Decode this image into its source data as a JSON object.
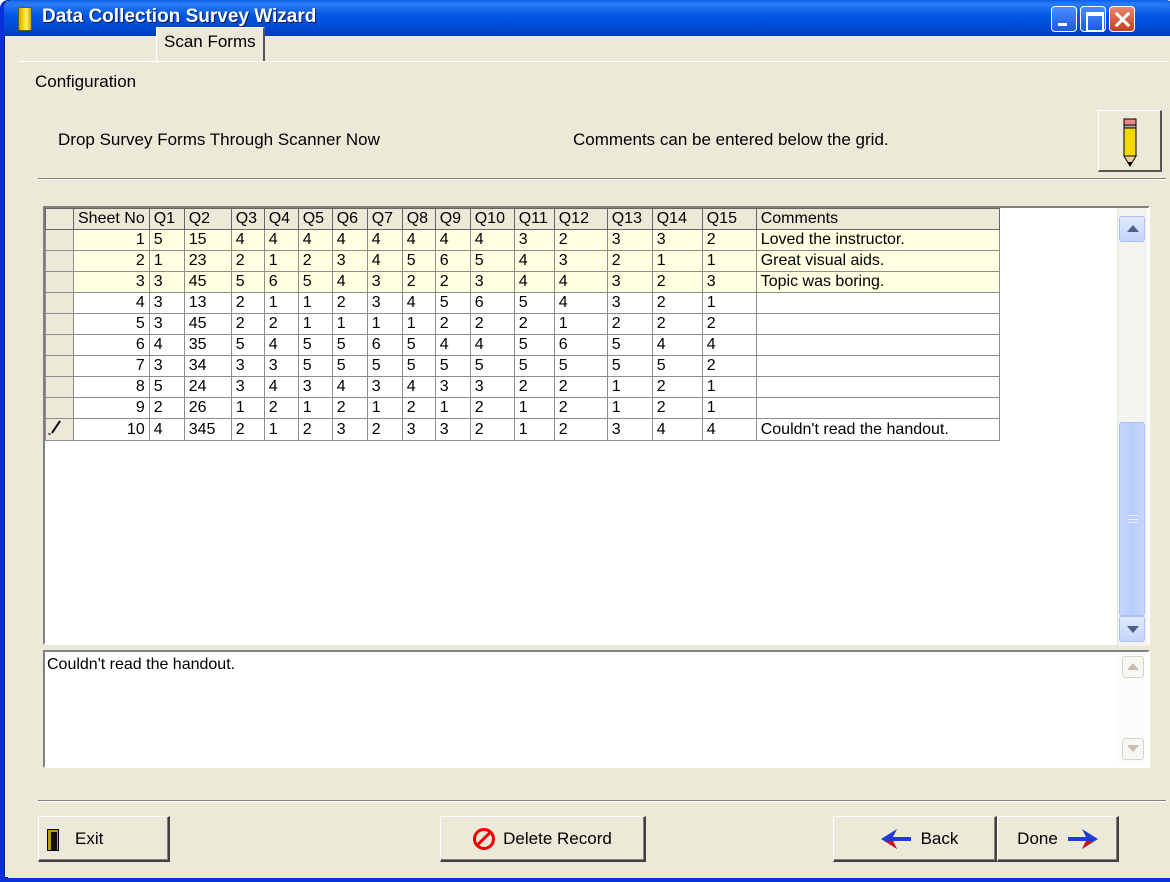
{
  "window": {
    "title": "Data Collection Survey Wizard"
  },
  "tabs": [
    {
      "label": "Configuration"
    },
    {
      "label": "Scan Forms"
    }
  ],
  "instructions": {
    "left": "Drop Survey Forms Through Scanner Now",
    "right": "Comments can be entered below the grid."
  },
  "grid": {
    "columns": [
      "Sheet No",
      "Q1",
      "Q2",
      "Q3",
      "Q4",
      "Q5",
      "Q6",
      "Q7",
      "Q8",
      "Q9",
      "Q10",
      "Q11",
      "Q12",
      "Q13",
      "Q14",
      "Q15",
      "Comments"
    ],
    "rows": [
      [
        "1",
        "5",
        "15",
        "4",
        "4",
        "4",
        "4",
        "4",
        "4",
        "4",
        "4",
        "3",
        "2",
        "3",
        "3",
        "2",
        "Loved the instructor."
      ],
      [
        "2",
        "1",
        "23",
        "2",
        "1",
        "2",
        "3",
        "4",
        "5",
        "6",
        "5",
        "4",
        "3",
        "2",
        "1",
        "1",
        "Great visual aids."
      ],
      [
        "3",
        "3",
        "45",
        "5",
        "6",
        "5",
        "4",
        "3",
        "2",
        "2",
        "3",
        "4",
        "4",
        "3",
        "2",
        "3",
        "Topic was boring."
      ],
      [
        "4",
        "3",
        "13",
        "2",
        "1",
        "1",
        "2",
        "3",
        "4",
        "5",
        "6",
        "5",
        "4",
        "3",
        "2",
        "1",
        ""
      ],
      [
        "5",
        "3",
        "45",
        "2",
        "2",
        "1",
        "1",
        "1",
        "1",
        "2",
        "2",
        "2",
        "1",
        "2",
        "2",
        "2",
        ""
      ],
      [
        "6",
        "4",
        "35",
        "5",
        "4",
        "5",
        "5",
        "6",
        "5",
        "4",
        "4",
        "5",
        "6",
        "5",
        "4",
        "4",
        ""
      ],
      [
        "7",
        "3",
        "34",
        "3",
        "3",
        "5",
        "5",
        "5",
        "5",
        "5",
        "5",
        "5",
        "5",
        "5",
        "5",
        "2",
        ""
      ],
      [
        "8",
        "5",
        "24",
        "3",
        "4",
        "3",
        "4",
        "3",
        "4",
        "3",
        "3",
        "2",
        "2",
        "1",
        "2",
        "1",
        ""
      ],
      [
        "9",
        "2",
        "26",
        "1",
        "2",
        "1",
        "2",
        "1",
        "2",
        "1",
        "2",
        "1",
        "2",
        "1",
        "2",
        "1",
        ""
      ],
      [
        "10",
        "4",
        "345",
        "2",
        "1",
        "2",
        "3",
        "2",
        "3",
        "3",
        "2",
        "1",
        "2",
        "3",
        "4",
        "4",
        "Couldn't read the handout."
      ]
    ],
    "highlighted_rows": 3,
    "editing_row": 10
  },
  "comment": {
    "value": "Couldn't read the handout."
  },
  "buttons": {
    "exit": "Exit",
    "delete": "Delete Record",
    "back": "Back",
    "done": "Done"
  },
  "colors": {
    "titlebar": "#0054e3",
    "highlight_row": "#ffffe1",
    "face": "#ece9d8",
    "arrow": "#1f3dd6"
  },
  "icons": {
    "title": "pencil-icon",
    "header_button": "pencil-icon",
    "exit": "door-icon",
    "delete": "no-entry-icon",
    "back": "arrow-left-icon",
    "done": "arrow-right-icon",
    "edit_row": "pencil-edit-icon"
  }
}
